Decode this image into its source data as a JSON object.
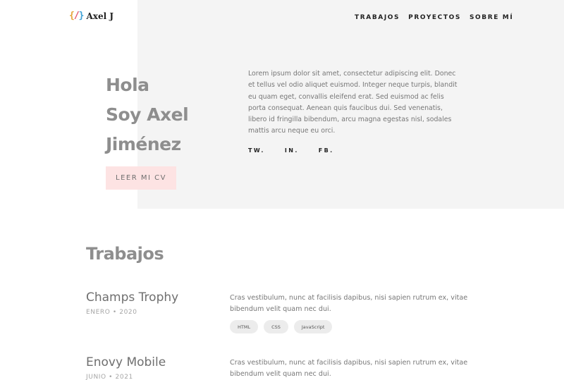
{
  "logo": {
    "icon_left": "{",
    "icon_mid": "/",
    "icon_right": "}",
    "text": "Axel J"
  },
  "nav": {
    "items": [
      "TRABAJOS",
      "PROYECTOS",
      "SOBRE MÍ"
    ]
  },
  "hero": {
    "title_lines": [
      "Hola",
      "Soy Axel",
      "Jiménez"
    ],
    "button_label": "LEER MI CV",
    "description": "Lorem ipsum dolor sit amet, consectetur adipiscing elit. Donec et tellus vel odio aliquet euismod. Integer neque turpis, blandit eu quam eget, convallis eleifend erat. Sed euismod ac felis porta consequat. Aenean quis faucibus dui. Sed venenatis, libero id fringilla bibendum, arcu magna egestas nisl, sodales mattis arcu neque eu orci.",
    "socials": [
      "TW.",
      "IN.",
      "FB."
    ]
  },
  "works": {
    "title": "Trabajos",
    "items": [
      {
        "name": "Champs Trophy",
        "date": "ENERO • 2020",
        "description": "Cras vestibulum, nunc at facilisis dapibus, nisi sapien rutrum ex, vitae bibendum velit quam nec dui.",
        "tags": [
          "HTML",
          "CSS",
          "JavaScript"
        ]
      },
      {
        "name": "Enovy Mobile",
        "date": "JUNIO • 2021",
        "description": "Cras vestibulum, nunc at facilisis dapibus, nisi sapien rutrum ex, vitae bibendum velit quam nec dui."
      }
    ]
  },
  "colors": {
    "hero_bg": "#f4f4f4",
    "button_bg": "#fde3e3",
    "heading": "#8e8e8e",
    "tag_bg": "#ececec"
  }
}
